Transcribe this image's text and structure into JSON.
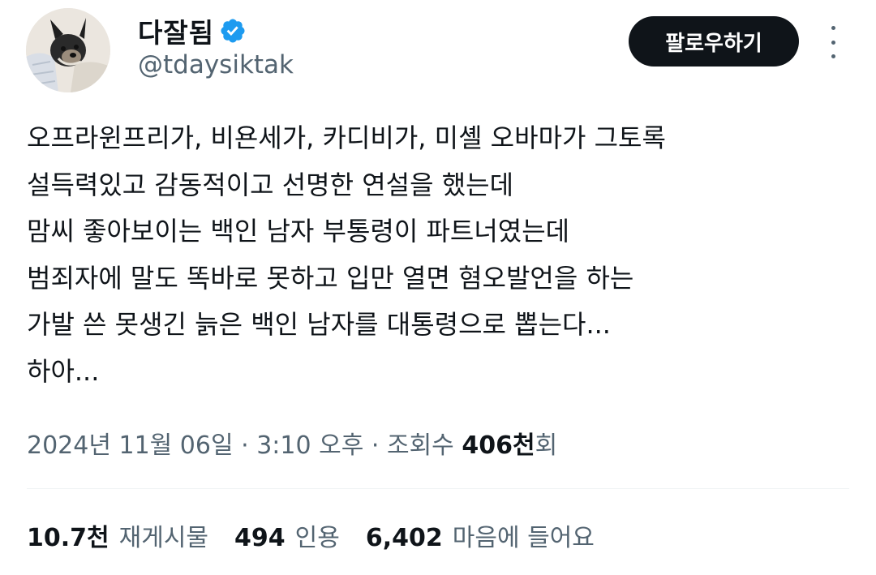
{
  "author": {
    "display_name": "다잘됨",
    "handle": "@tdaysiktak",
    "verified_icon": "verified-badge-icon",
    "verified_color": "#1d9bf0"
  },
  "actions": {
    "follow_label": "팔로우하기",
    "more_icon": "more-options-icon"
  },
  "tweet": {
    "lines": [
      "오프라윈프리가, 비욘세가, 카디비가, 미셸 오바마가 그토록",
      "설득력있고 감동적이고 선명한 연설을 했는데",
      "맘씨 좋아보이는 백인 남자 부통령이 파트너였는데",
      "범죄자에 말도 똑바로 못하고 입만 열면 혐오발언을 하는",
      "가발 쓴 못생긴 늙은 백인 남자를 대통령으로 뽑는다...",
      "하아..."
    ]
  },
  "meta": {
    "date": "2024년 11월 06일",
    "separator": "·",
    "time": "3:10 오후",
    "views_label": "조회수",
    "views_count": "406천",
    "views_suffix": "회"
  },
  "stats": {
    "reposts_value": "10.7천",
    "reposts_label": "재게시물",
    "quotes_value": "494",
    "quotes_label": "인용",
    "likes_value": "6,402",
    "likes_label": "마음에 들어요"
  },
  "colors": {
    "text_primary": "#0f1419",
    "text_secondary": "#536471",
    "button_bg": "#0f1419",
    "divider": "#eff3f4"
  }
}
